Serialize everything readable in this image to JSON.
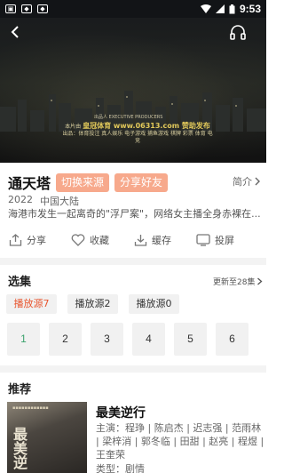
{
  "status_bar": {
    "time": "9:53"
  },
  "video": {
    "watermark": "皇冠体育 www.06313.com 赞助发布",
    "credits_line1": "本片由",
    "credits_line2": "出品：体育投注  真人娱乐  电子游戏  捕鱼游戏  棋牌  彩票  体育 电竞",
    "producer": "出品人 EXECUTIVE PRODUCERS"
  },
  "show": {
    "title": "通天塔",
    "switch_source_label": "切换来源",
    "share_friend_label": "分享好友",
    "intro_label": "简介",
    "year": "2022",
    "region": "中国大陆",
    "description": "海港市发生一起离奇的\"浮尸案\"，网络女主播全身赤裸在..."
  },
  "actions": [
    {
      "label": "分享",
      "icon": "share-icon"
    },
    {
      "label": "收藏",
      "icon": "heart-icon"
    },
    {
      "label": "缓存",
      "icon": "download-icon"
    },
    {
      "label": "投屏",
      "icon": "cast-icon"
    }
  ],
  "episodes_section": {
    "title": "选集",
    "update_info": "更新至28集",
    "sources": [
      "播放源7",
      "播放源2",
      "播放源0"
    ],
    "episodes": [
      "1",
      "2",
      "3",
      "4",
      "5",
      "6"
    ]
  },
  "recommend": {
    "title": "推荐",
    "item": {
      "name": "最美逆行",
      "cast": "主演：程琤 | 陈启杰 | 迟志强 | 范雨林 | 梁梓消 | 郭冬临 | 田甜 | 赵亮 | 程煜 | 王奎荣",
      "type": "类型：剧情",
      "poster_title": "最美逆"
    }
  },
  "colors": {
    "accent": "#f7a98c",
    "active_source": "#e8552e",
    "active_episode": "#3aa26c"
  }
}
